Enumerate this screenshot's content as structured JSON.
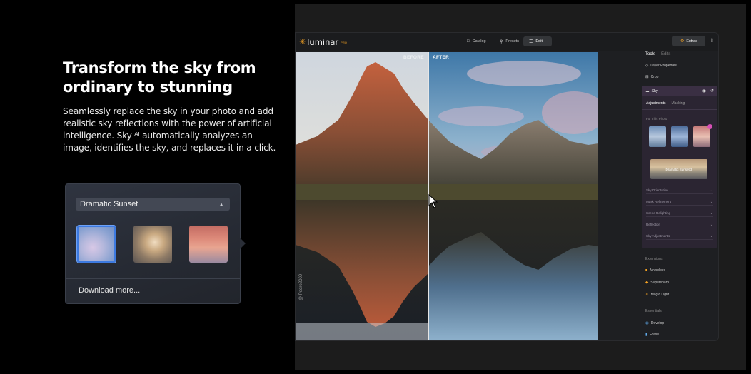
{
  "marketing": {
    "headline": "Transform the sky from ordinary to stunning",
    "body": "Seamlessly replace the sky in your photo and add realistic sky reflections with the power of artificial intelligence. Sky ᴬᴵ automatically analyzes an image, identifies the sky, and replaces it in a click."
  },
  "picker": {
    "selected": "Dramatic Sunset",
    "thumbnails": [
      "sky-thumbnail-1",
      "sky-thumbnail-2",
      "sky-thumbnail-3"
    ],
    "selected_index": 0,
    "footer": "Download more..."
  },
  "app": {
    "logo": "luminar",
    "logo_badge": "PRO",
    "nav": {
      "catalog": "Catalog",
      "presets": "Presets",
      "edit": "Edit",
      "extras": "Extras"
    },
    "photo": {
      "before": "BEFORE",
      "after": "AFTER",
      "watermark": "@ Pedro2009"
    },
    "panel": {
      "tab_tools": "Tools",
      "tab_edits": "Edits",
      "layer_properties": "Layer Properties",
      "crop": "Crop",
      "sky": "Sky",
      "subtab_adjustments": "Adjustments",
      "subtab_masking": "Masking",
      "for_this_photo": "For This Photo",
      "dramatic_sunset": "Dramatic Sunset 3",
      "accordions": [
        "Sky Orientation",
        "Mask Refinement",
        "Scene Relighting",
        "Reflection",
        "Sky Adjustments"
      ],
      "extensions_title": "Extensions",
      "extensions": [
        "Noiseless",
        "Supersharp",
        "Magic Light"
      ],
      "essentials_title": "Essentials",
      "essentials": [
        "Develop",
        "Erase"
      ]
    }
  },
  "colors": {
    "accent": "#f6a323",
    "selection": "#3d7ae0",
    "badge": "#d850b7"
  }
}
